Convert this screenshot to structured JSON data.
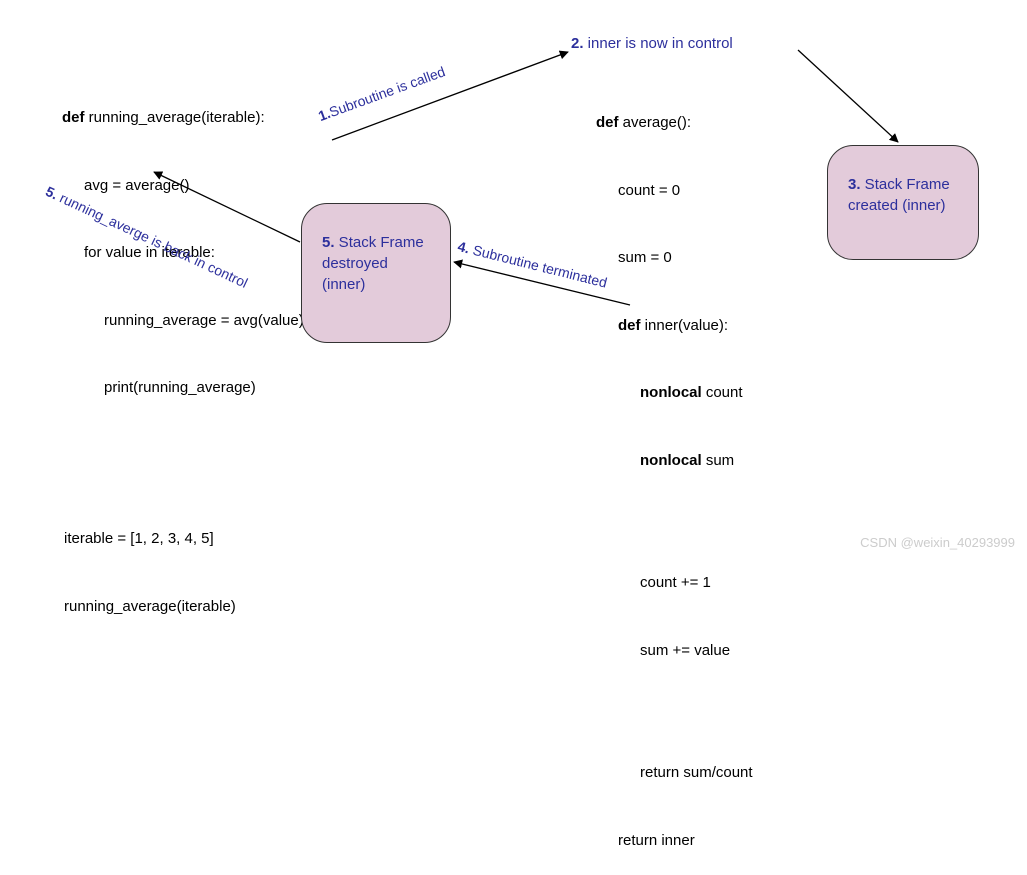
{
  "left_code": {
    "l1": "def running_average(iterable):",
    "l2": "avg = average()",
    "l3": "for value in iterable:",
    "l4": "running_average = avg(value)",
    "l5": "print(running_average)"
  },
  "right_code": {
    "l1": "def average():",
    "l2": "count = 0",
    "l3": "sum = 0",
    "l4": "def inner(value):",
    "l5": "nonlocal count",
    "l6": "nonlocal sum",
    "l7": "count += 1",
    "l8": "sum += value",
    "l9": "return sum/count",
    "l10": "return inner"
  },
  "bottom_code": {
    "l1": "iterable = [1, 2, 3, 4, 5]",
    "l2": "running_average(iterable)"
  },
  "annotations": {
    "a1_num": "1.",
    "a1_text": "Subroutine is called",
    "a2_num": "2.",
    "a2_text": " inner is now in control",
    "a3_num": "3.",
    "a3_text": " Stack Frame created (inner)",
    "a4_num": "4.",
    "a4_text": " Subroutine terminated",
    "a5box_num": "5.",
    "a5box_text": " Stack Frame destroyed (inner)",
    "a5_num": "5.",
    "a5_text": " running_averge is back in control"
  },
  "watermark": "CSDN @weixin_40293999"
}
